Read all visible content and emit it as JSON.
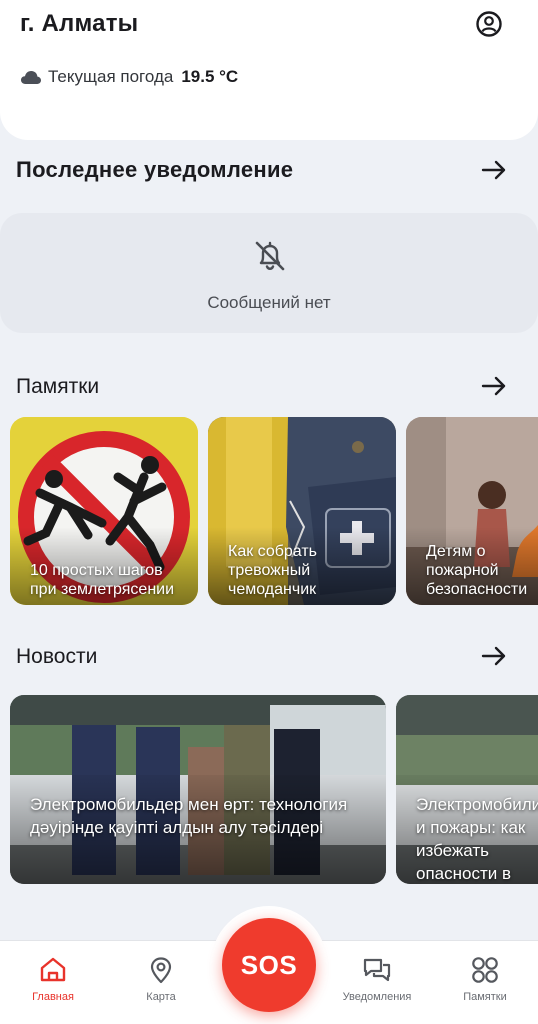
{
  "header": {
    "city": "г. Алматы",
    "weather_label": "Текущая погода",
    "weather_value": "19.5 °C"
  },
  "last_notification": {
    "title": "Последнее уведомление",
    "empty_text": "Сообщений нет"
  },
  "tips": {
    "title": "Памятки",
    "items": [
      {
        "label": "10 простых шагов при землетрясении"
      },
      {
        "label": "Как собрать тревожный чемоданчик"
      },
      {
        "label": "Детям о пожарной безопасности"
      }
    ]
  },
  "news": {
    "title": "Новости",
    "items": [
      {
        "label": "Электромобильдер мен өрт: технология дәуірінде қауіпті алдын алу  тәсілдері"
      },
      {
        "label": "Электромобили и пожары: как избежать опасности в эпоху технологий"
      }
    ]
  },
  "tabbar": {
    "home": "Главная",
    "map": "Карта",
    "sos": "SOS",
    "notifications": "Уведомления",
    "tips": "Памятки"
  },
  "colors": {
    "accent": "#ef3b2d",
    "background": "#eef1f6"
  }
}
